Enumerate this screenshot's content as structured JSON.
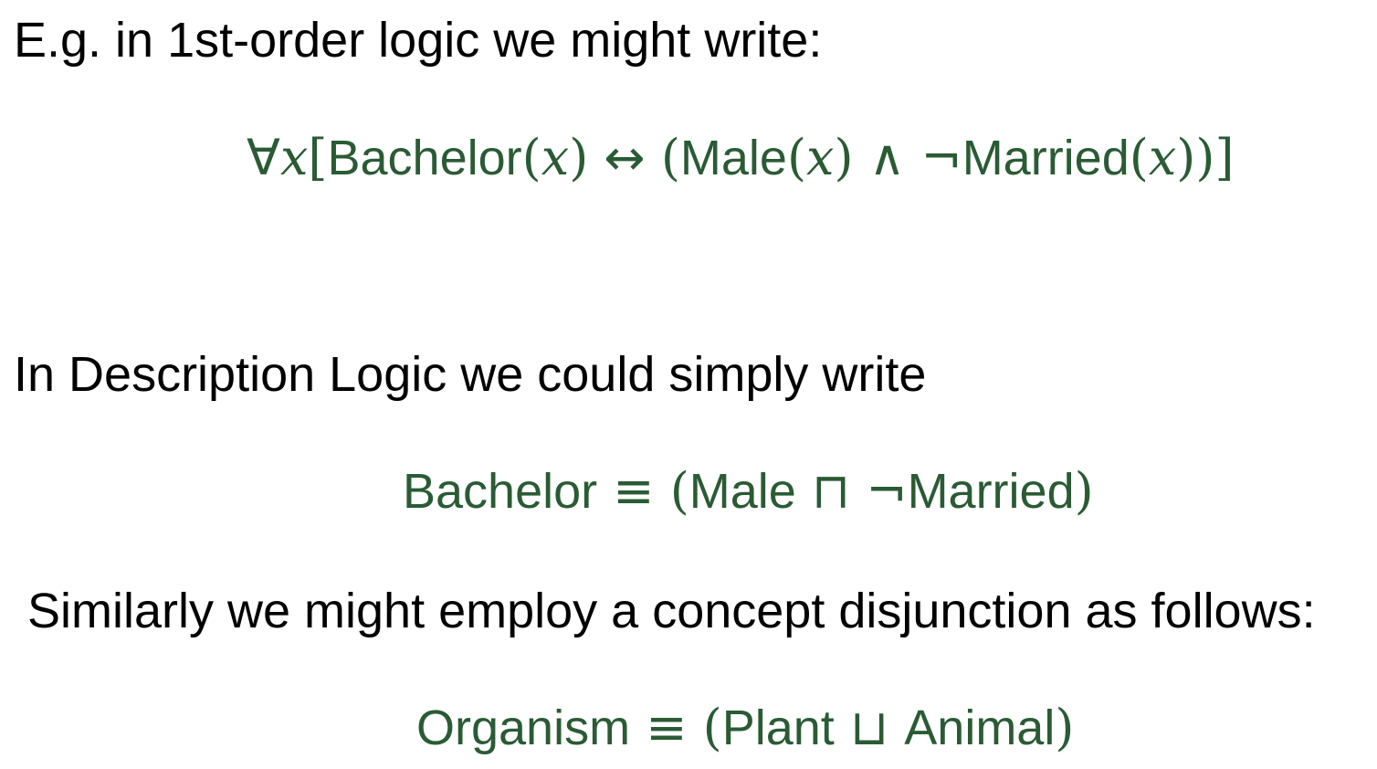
{
  "colors": {
    "text": "#000000",
    "formula": "#2a5b34",
    "background": "#ffffff"
  },
  "intro": "E.g. in 1st-order logic we might write:",
  "fol_formula": {
    "forall": "∀",
    "var_x": "x",
    "open_bracket": "[",
    "bachelor": "Bachelor",
    "paren_x_1": "(",
    "arg_x_1": "x",
    "close_x_1": ")",
    "iff": " ↔ ",
    "open_paren": "(",
    "male": "Male",
    "paren_x_2": "(",
    "arg_x_2": "x",
    "close_x_2": ")",
    "and": " ∧ ",
    "not": "¬",
    "married": "Married",
    "paren_x_3": "(",
    "arg_x_3": "x",
    "close_x_3": ")",
    "close_paren": ")",
    "close_bracket": "]"
  },
  "dl_intro": "In Description Logic we could simply write",
  "dl_formula": {
    "bachelor": "Bachelor",
    "equiv": " ≡ ",
    "open_paren": "(",
    "male": "Male",
    "conj": " ⊓ ",
    "not": "¬",
    "married": "Married",
    "close_paren": ")"
  },
  "disj_intro": "Similarly we might employ a concept disjunction as follows:",
  "disj_formula": {
    "organism": "Organism",
    "equiv": " ≡ ",
    "open_paren": "(",
    "plant": "Plant",
    "disj": " ⊔ ",
    "animal": "Animal",
    "close_paren": ")"
  }
}
